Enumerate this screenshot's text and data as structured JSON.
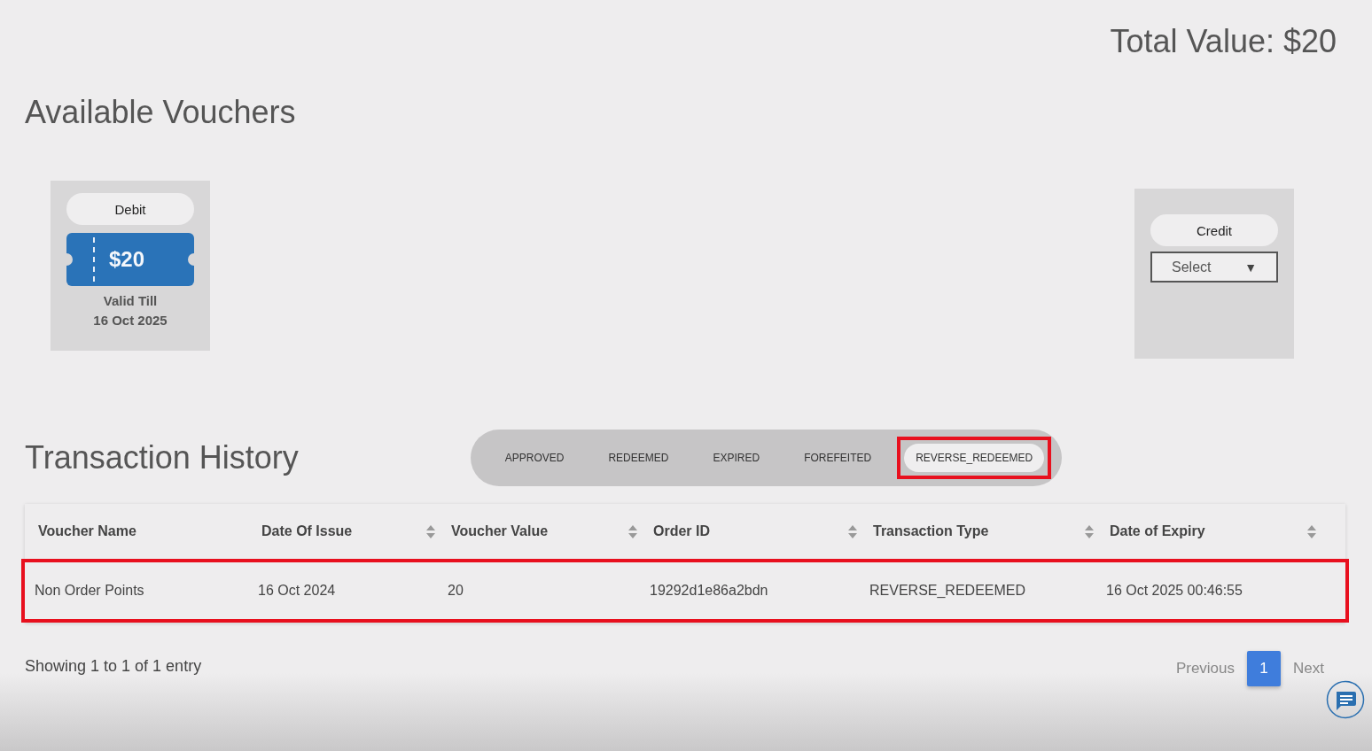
{
  "total_value": "Total Value: $20",
  "vouchers_title": "Available Vouchers",
  "debit_card": {
    "type_label": "Debit",
    "amount": "$20",
    "valid_label": "Valid Till",
    "valid_date": "16 Oct 2025"
  },
  "credit_card": {
    "type_label": "Credit",
    "select": {
      "value": "Select",
      "caret": "▼"
    }
  },
  "history_title": "Transaction History",
  "tabs": [
    {
      "label": "APPROVED",
      "selected": false,
      "highlighted": false
    },
    {
      "label": "REDEEMED",
      "selected": false,
      "highlighted": false
    },
    {
      "label": "EXPIRED",
      "selected": false,
      "highlighted": false
    },
    {
      "label": "FOREFEITED",
      "selected": false,
      "highlighted": false
    },
    {
      "label": "REVERSE_REDEEMED",
      "selected": true,
      "highlighted": true
    }
  ],
  "table": {
    "columns": [
      {
        "label": "Voucher Name",
        "sortable": false
      },
      {
        "label": "Date Of Issue",
        "sortable": true
      },
      {
        "label": "Voucher Value",
        "sortable": true
      },
      {
        "label": "Order ID",
        "sortable": true
      },
      {
        "label": "Transaction Type",
        "sortable": true
      },
      {
        "label": "Date of Expiry",
        "sortable": true
      }
    ],
    "rows": [
      {
        "highlighted": true,
        "cells": [
          "Non Order Points",
          "16 Oct 2024",
          "20",
          "19292d1e86a2bdn",
          "REVERSE_REDEEMED",
          "16 Oct 2025 00:46:55"
        ]
      }
    ]
  },
  "footer": {
    "info": "Showing 1 to 1 of 1 entry",
    "pagination": [
      {
        "label": "Previous",
        "selected": false
      },
      {
        "label": "1",
        "selected": true
      },
      {
        "label": "Next",
        "selected": false
      }
    ]
  }
}
